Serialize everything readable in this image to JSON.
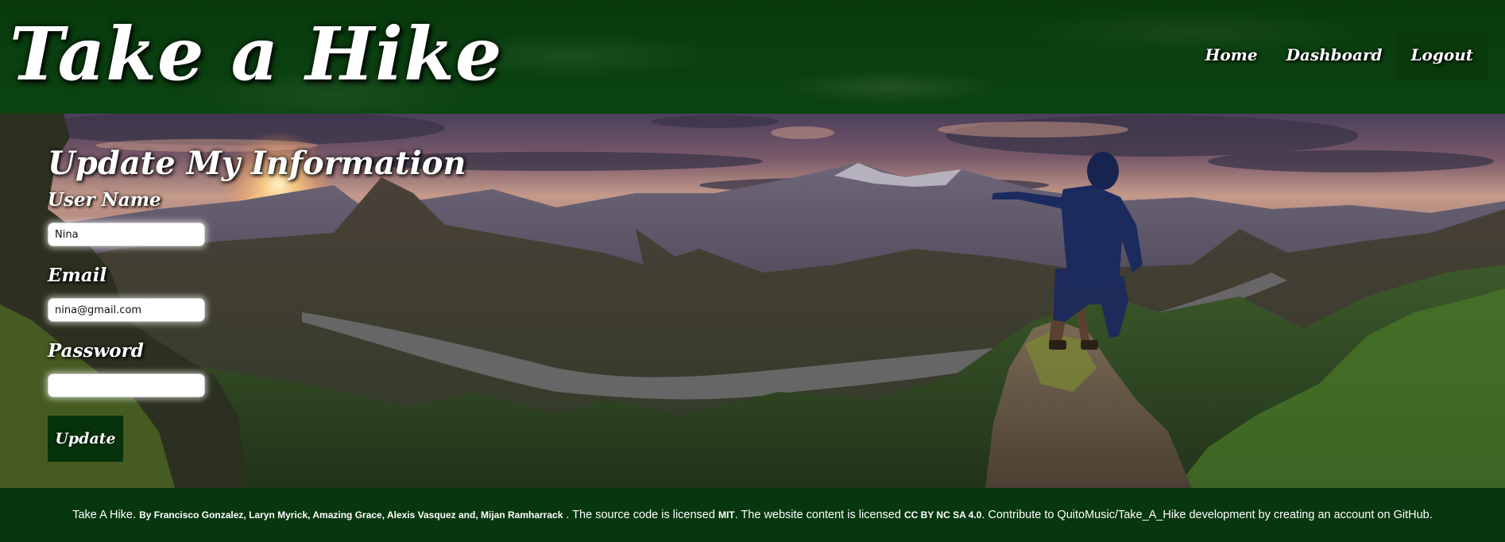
{
  "header": {
    "logo": "Take a Hike",
    "nav": [
      {
        "label": "Home"
      },
      {
        "label": "Dashboard"
      },
      {
        "label": "Logout"
      }
    ]
  },
  "form": {
    "title": "Update My Information",
    "username_label": "User Name",
    "username_value": "Nina",
    "email_label": "Email",
    "email_value": "nina@gmail.com",
    "password_label": "Password",
    "password_value": "",
    "submit_label": "Update"
  },
  "footer": {
    "site_name": "Take A Hike.",
    "authors": "By Francisco Gonzalez, Laryn Myrick, Amazing Grace, Alexis Vasquez and, Mijan Ramharrack",
    "code_license_text": " . The source code is licensed ",
    "code_license": "MIT",
    "content_license_text": ". The website content is licensed ",
    "content_license": "CC BY NC SA 4.0",
    "contribute_text": ". Contribute to QuitoMusic/Take_A_Hike development by creating an account on GitHub."
  },
  "colors": {
    "header_green": "#083a0c",
    "button_green": "#07330a",
    "footer_green": "#083a0e",
    "text": "#ffffff"
  },
  "icons": {
    "hero_image": "mountain-landscape-hiker"
  }
}
